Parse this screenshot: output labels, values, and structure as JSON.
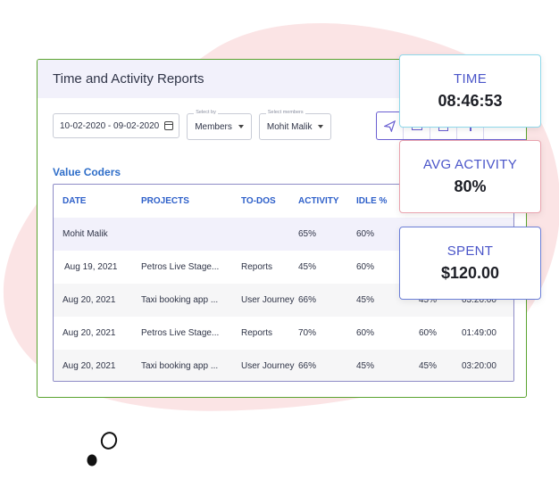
{
  "panel": {
    "title": "Time and Activity Reports",
    "date_range": "10-02-2020 - 09-02-2020",
    "select_by": {
      "caption": "Select by",
      "value": "Members"
    },
    "select_members": {
      "caption": "Select members",
      "value": "Mohit Malik"
    },
    "toolbar_icons": [
      "send-icon",
      "mail-icon",
      "calendar-icon",
      "info-icon"
    ],
    "group_label": "Value Coders"
  },
  "table": {
    "columns": [
      "DATE",
      "PROJECTS",
      "TO-DOS",
      "ACTIVITY",
      "IDLE %",
      "",
      ""
    ],
    "summary": [
      "Mohit Malik",
      "",
      "",
      "65%",
      "60%",
      "",
      ""
    ],
    "rows": [
      [
        "Aug 19, 2021",
        "Petros Live Stage...",
        "Reports",
        "45%",
        "60%",
        "",
        ""
      ],
      [
        "Aug 20, 2021",
        "Taxi booking app ...",
        "User Journey",
        "66%",
        "45%",
        "45%",
        "03:20:00"
      ],
      [
        "Aug 20, 2021",
        "Petros Live Stage...",
        "Reports",
        "70%",
        "60%",
        "60%",
        "01:49:00"
      ],
      [
        "Aug 20, 2021",
        "Taxi booking app ...",
        "User Journey",
        "66%",
        "45%",
        "45%",
        "03:20:00"
      ]
    ]
  },
  "cards": {
    "time": {
      "label": "TIME",
      "value": "08:46:53"
    },
    "avg_activity": {
      "label": "AVG ACTIVITY",
      "value": "80%"
    },
    "spent": {
      "label": "SPENT",
      "value": "$120.00"
    }
  },
  "colors": {
    "accent": "#6a5fd1",
    "panel_border": "#5aa32f",
    "header_bg": "#f2f1fb",
    "blob": "#fbe4e5",
    "time_border": "#8fd8ea",
    "avg_border": "#e9a3ae",
    "spent_border": "#6c7fd8"
  }
}
